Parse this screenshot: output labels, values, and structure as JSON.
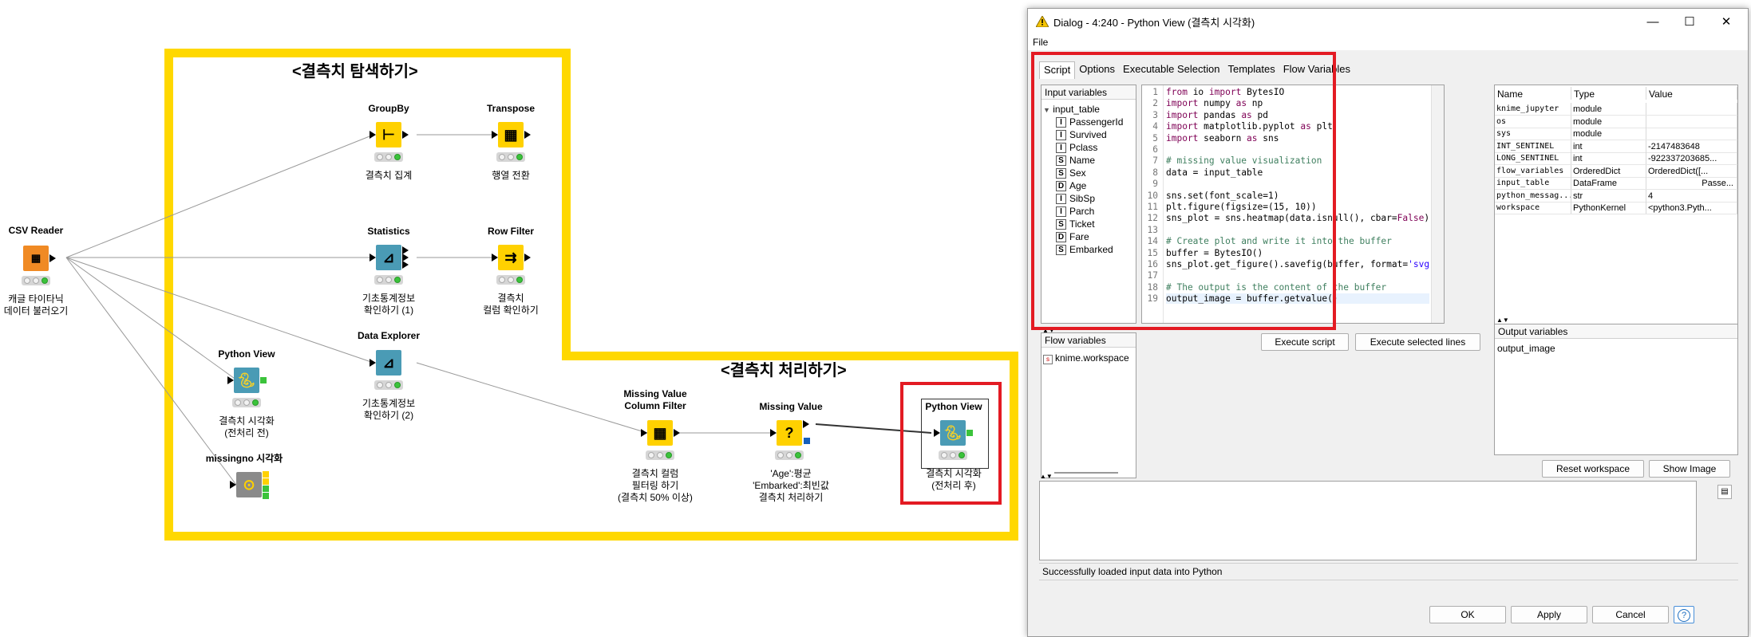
{
  "workflow": {
    "annotations": {
      "explore_title": "<결측치 탐색하기>",
      "handle_title": "<결측치 처리하기>"
    },
    "nodes": {
      "csv_reader": {
        "title": "CSV Reader",
        "label1": "캐글 타이타닉",
        "label2": "데이터 불러오기"
      },
      "groupby": {
        "title": "GroupBy",
        "label1": "결측치 집계",
        "label2": ""
      },
      "transpose": {
        "title": "Transpose",
        "label1": "행열 전환",
        "label2": ""
      },
      "statistics": {
        "title": "Statistics",
        "label1": "기초통계정보",
        "label2": "확인하기 (1)"
      },
      "row_filter": {
        "title": "Row Filter",
        "label1": "결측치",
        "label2": "컬럼 확인하기"
      },
      "data_explorer": {
        "title": "Data Explorer",
        "label1": "기초통계정보",
        "label2": "확인하기 (2)"
      },
      "python_view_1": {
        "title": "Python View",
        "label1": "결측치 시각화",
        "label2": "(전처리 전)"
      },
      "missingno": {
        "title": "missingno 시각화",
        "label1": "",
        "label2": ""
      },
      "mv_column_filter": {
        "title1": "Missing Value",
        "title2": "Column Filter",
        "label1": "결측치 컬럼",
        "label2": "필터링 하기",
        "label3": "(결측치 50% 이상)"
      },
      "missing_value": {
        "title": "Missing Value",
        "label1": "'Age':평균",
        "label2": "'Embarked':최빈값",
        "label3": "결측치 처리하기"
      },
      "python_view_2": {
        "title": "Python View",
        "label1": "결측치 시각화",
        "label2": "(전처리 후)"
      }
    }
  },
  "dialog": {
    "title": "Dialog - 4:240 - Python View (결측치 시각화)",
    "menu_file": "File",
    "window_controls": {
      "minimize": "—",
      "maximize": "☐",
      "close": "✕"
    },
    "tabs": [
      "Script",
      "Options",
      "Executable Selection",
      "Templates",
      "Flow Variables"
    ],
    "input_variables": {
      "header": "Input variables",
      "table": "input_table",
      "columns": [
        {
          "type": "I",
          "name": "PassengerId"
        },
        {
          "type": "I",
          "name": "Survived"
        },
        {
          "type": "I",
          "name": "Pclass"
        },
        {
          "type": "S",
          "name": "Name"
        },
        {
          "type": "S",
          "name": "Sex"
        },
        {
          "type": "D",
          "name": "Age"
        },
        {
          "type": "I",
          "name": "SibSp"
        },
        {
          "type": "I",
          "name": "Parch"
        },
        {
          "type": "S",
          "name": "Ticket"
        },
        {
          "type": "D",
          "name": "Fare"
        },
        {
          "type": "S",
          "name": "Embarked"
        }
      ]
    },
    "flow_variables": {
      "header": "Flow variables",
      "items": [
        "knime.workspace"
      ]
    },
    "code_lines": [
      "from io import BytesIO",
      "import numpy as np",
      "import pandas as pd",
      "import matplotlib.pyplot as plt",
      "import seaborn as sns",
      "",
      "# missing value visualization",
      "data = input_table",
      "",
      "sns.set(font_scale=1)",
      "plt.figure(figsize=(15, 10))",
      "sns_plot = sns.heatmap(data.isnull(), cbar=False)",
      "",
      "# Create plot and write it into the buffer",
      "buffer = BytesIO()",
      "sns_plot.get_figure().savefig(buffer, format='svg')",
      "",
      "# The output is the content of the buffer",
      "output_image = buffer.getvalue()"
    ],
    "workspace_table": {
      "headers": [
        "Name",
        "Type",
        "Value"
      ],
      "rows": [
        [
          "knime_jupyter",
          "module",
          ""
        ],
        [
          "os",
          "module",
          ""
        ],
        [
          "sys",
          "module",
          ""
        ],
        [
          "INT_SENTINEL",
          "int",
          "-2147483648"
        ],
        [
          "LONG_SENTINEL",
          "int",
          "-922337203685..."
        ],
        [
          "flow_variables",
          "OrderedDict",
          "OrderedDict([..."
        ],
        [
          "input_table",
          "DataFrame",
          "Passe..."
        ],
        [
          "python_messag...",
          "str",
          "4"
        ],
        [
          "workspace",
          "PythonKernel",
          "<python3.Pyth..."
        ]
      ]
    },
    "output_variables": {
      "header": "Output variables",
      "items": [
        "output_image"
      ]
    },
    "buttons": {
      "execute_script": "Execute script",
      "execute_selected": "Execute selected lines",
      "reset_workspace": "Reset workspace",
      "show_image": "Show Image",
      "ok": "OK",
      "apply": "Apply",
      "cancel": "Cancel",
      "help": "?"
    },
    "status": "Successfully loaded input data into Python",
    "colors": {
      "highlight": "#e31b23",
      "annotation": "#FFD800"
    }
  }
}
